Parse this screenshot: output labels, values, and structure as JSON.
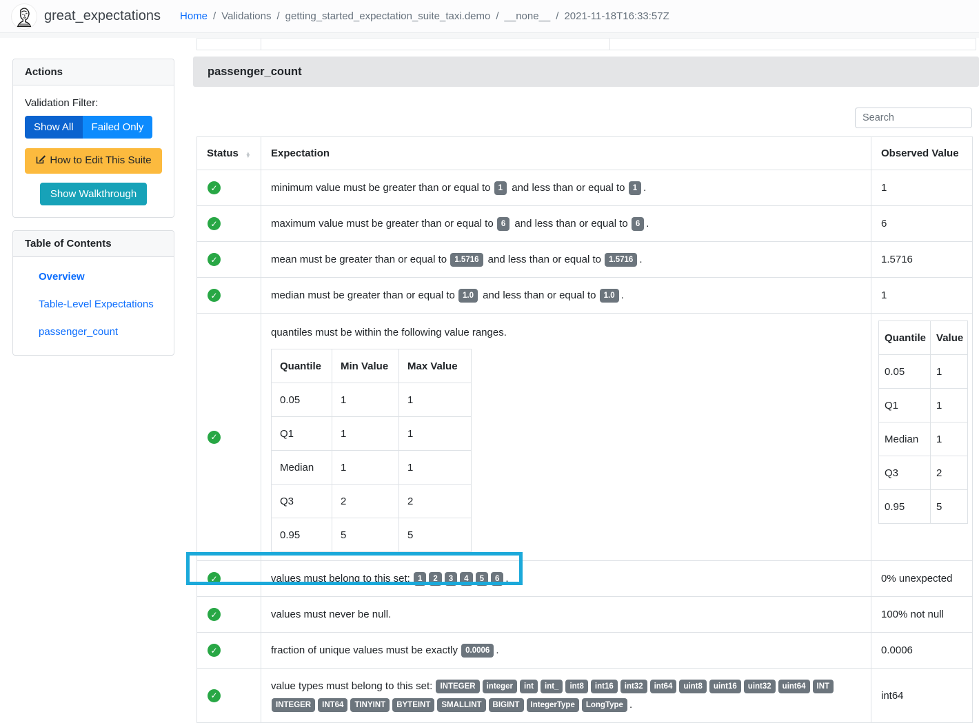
{
  "navbar": {
    "brand": "great_expectations",
    "separator": "/",
    "breadcrumb": [
      {
        "label": "Home",
        "link": true
      },
      {
        "label": "Validations",
        "link": false
      },
      {
        "label": "getting_started_expectation_suite_taxi.demo",
        "link": false
      },
      {
        "label": "__none__",
        "link": false
      },
      {
        "label": "2021-11-18T16:33:57Z",
        "link": false
      }
    ]
  },
  "sidebar": {
    "actions": {
      "title": "Actions",
      "filter_label": "Validation Filter:",
      "show_all_label": "Show All",
      "failed_only_label": "Failed Only",
      "edit_suite_label": "How to Edit This Suite",
      "walkthrough_label": "Show Walkthrough"
    },
    "toc": {
      "title": "Table of Contents",
      "items": [
        "Overview",
        "Table-Level Expectations",
        "passenger_count"
      ]
    }
  },
  "main": {
    "section_title": "passenger_count",
    "search_placeholder": "Search",
    "table": {
      "headers": [
        "Status",
        "Expectation",
        "Observed Value"
      ],
      "rows": [
        {
          "status": "pass",
          "segments": [
            {
              "t": "minimum value must be greater than or equal to "
            },
            {
              "b": "1"
            },
            {
              "t": " and less than or equal to "
            },
            {
              "b": "1"
            },
            {
              "t": "."
            }
          ],
          "observed": "1"
        },
        {
          "status": "pass",
          "segments": [
            {
              "t": "maximum value must be greater than or equal to "
            },
            {
              "b": "6"
            },
            {
              "t": " and less than or equal to "
            },
            {
              "b": "6"
            },
            {
              "t": "."
            }
          ],
          "observed": "6"
        },
        {
          "status": "pass",
          "segments": [
            {
              "t": "mean must be greater than or equal to "
            },
            {
              "b": "1.5716"
            },
            {
              "t": " and less than or equal to "
            },
            {
              "b": "1.5716"
            },
            {
              "t": "."
            }
          ],
          "observed": "1.5716"
        },
        {
          "status": "pass",
          "segments": [
            {
              "t": "median must be greater than or equal to "
            },
            {
              "b": "1.0"
            },
            {
              "t": " and less than or equal to "
            },
            {
              "b": "1.0"
            },
            {
              "t": "."
            }
          ],
          "observed": "1"
        },
        {
          "status": "pass",
          "segments": [
            {
              "t": "quantiles must be within the following value ranges."
            }
          ],
          "nested_table": {
            "headers": [
              "Quantile",
              "Min Value",
              "Max Value"
            ],
            "rows": [
              [
                "0.05",
                "1",
                "1"
              ],
              [
                "Q1",
                "1",
                "1"
              ],
              [
                "Median",
                "1",
                "1"
              ],
              [
                "Q3",
                "2",
                "2"
              ],
              [
                "0.95",
                "5",
                "5"
              ]
            ]
          },
          "observed_table": {
            "headers": [
              "Quantile",
              "Value"
            ],
            "rows": [
              [
                "0.05",
                "1"
              ],
              [
                "Q1",
                "1"
              ],
              [
                "Median",
                "1"
              ],
              [
                "Q3",
                "2"
              ],
              [
                "0.95",
                "5"
              ]
            ]
          }
        },
        {
          "status": "pass",
          "highlighted": true,
          "segments": [
            {
              "t": "values must belong to this set: "
            },
            {
              "b": "1"
            },
            {
              "b": "2"
            },
            {
              "b": "3"
            },
            {
              "b": "4"
            },
            {
              "b": "5"
            },
            {
              "b": "6"
            },
            {
              "t": "."
            }
          ],
          "observed": "0% unexpected"
        },
        {
          "status": "pass",
          "segments": [
            {
              "t": "values must never be null."
            }
          ],
          "observed": "100% not null"
        },
        {
          "status": "pass",
          "segments": [
            {
              "t": "fraction of unique values must be exactly "
            },
            {
              "b": "0.0006"
            },
            {
              "t": "."
            }
          ],
          "observed": "0.0006"
        },
        {
          "status": "pass",
          "segments": [
            {
              "t": "value types must belong to this set: "
            },
            {
              "b": "INTEGER"
            },
            {
              "b": "integer"
            },
            {
              "b": "int"
            },
            {
              "b": "int_"
            },
            {
              "b": "int8"
            },
            {
              "b": "int16"
            },
            {
              "b": "int32"
            },
            {
              "b": "int64"
            },
            {
              "b": "uint8"
            },
            {
              "b": "uint16"
            },
            {
              "b": "uint32"
            },
            {
              "b": "uint64"
            },
            {
              "b": "INT"
            },
            {
              "b": "INTEGER"
            },
            {
              "b": "INT64"
            },
            {
              "b": "TINYINT"
            },
            {
              "b": "BYTEINT"
            },
            {
              "b": "SMALLINT"
            },
            {
              "b": "BIGINT"
            },
            {
              "b": "IntegerType"
            },
            {
              "b": "LongType"
            },
            {
              "t": "."
            }
          ],
          "observed": "int64"
        }
      ]
    }
  },
  "colors": {
    "success_green": "#28a745",
    "badge_gray": "#6c757d",
    "highlight_cyan": "#1ba9da",
    "link_blue": "#0d6efd",
    "show_all_bg": "#0b63cf",
    "failed_only_bg": "#0d8bfd",
    "edit_suite_bg": "#fcba3e",
    "walkthrough_bg": "#17a2b8"
  }
}
